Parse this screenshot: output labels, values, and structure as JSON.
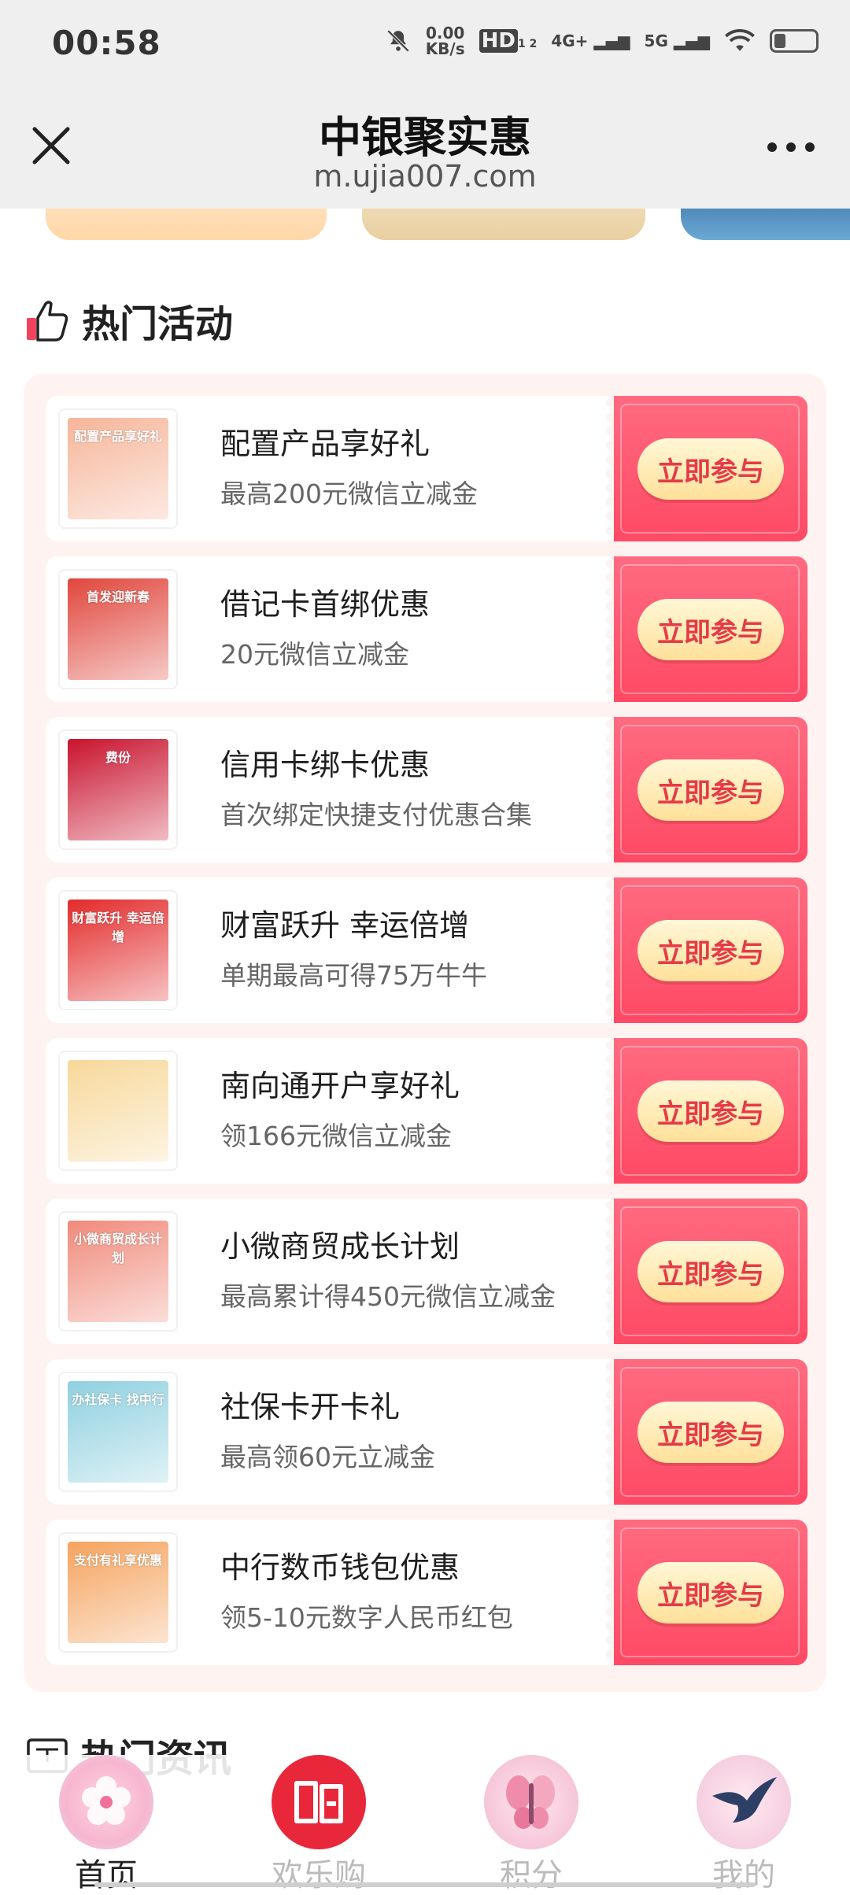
{
  "status_bar": {
    "time": "00:58",
    "net_speed_value": "0.00",
    "net_speed_unit": "KB/s",
    "hd_label": "HD",
    "hd_sub": "1 2",
    "sig1_label": "4G+",
    "sig2_label": "5G",
    "icons": [
      "mute-bell-icon",
      "wifi-icon",
      "battery-icon"
    ]
  },
  "header": {
    "title": "中银聚实惠",
    "url": "m.ujia007.com"
  },
  "hot_activities": {
    "title": "热门活动",
    "icon": "thumbs-up-icon",
    "items": [
      {
        "title": "配置产品享好礼",
        "subtitle": "最高200元微信立减金",
        "button": "立即参与",
        "thumb_text": "配置产品享好礼",
        "thumb_color": "#f6b59a"
      },
      {
        "title": "借记卡首绑优惠",
        "subtitle": "20元微信立减金",
        "button": "立即参与",
        "thumb_text": "首发迎新春",
        "thumb_color": "#e0463c"
      },
      {
        "title": "信用卡绑卡优惠",
        "subtitle": "首次绑定快捷支付优惠合集",
        "button": "立即参与",
        "thumb_text": "费份",
        "thumb_color": "#c9132e"
      },
      {
        "title": "财富跃升 幸运倍增",
        "subtitle": "单期最高可得75万牛牛",
        "button": "立即参与",
        "thumb_text": "财富跃升 幸运倍增",
        "thumb_color": "#e32a2a"
      },
      {
        "title": "南向通开户享好礼",
        "subtitle": "领166元微信立减金",
        "button": "立即参与",
        "thumb_text": "",
        "thumb_color": "#f7d89a"
      },
      {
        "title": "小微商贸成长计划",
        "subtitle": "最高累计得450元微信立减金",
        "button": "立即参与",
        "thumb_text": "小微商贸成长计划",
        "thumb_color": "#f08a7a"
      },
      {
        "title": "社保卡开卡礼",
        "subtitle": "最高领60元立减金",
        "button": "立即参与",
        "thumb_text": "办社保卡 找中行",
        "thumb_color": "#8fd0e0"
      },
      {
        "title": "中行数币钱包优惠",
        "subtitle": "领5-10元数字人民币红包",
        "button": "立即参与",
        "thumb_text": "支付有礼享优惠",
        "thumb_color": "#f5a35e"
      }
    ]
  },
  "hot_news": {
    "title": "热门资讯",
    "icon": "newspaper-icon"
  },
  "bottom_nav": {
    "items": [
      {
        "label": "首页",
        "icon": "cherry-blossom-icon",
        "active": true
      },
      {
        "label": "欢乐购",
        "icon": "shopping-gou-icon",
        "active": false
      },
      {
        "label": "积分",
        "icon": "butterfly-icon",
        "active": false
      },
      {
        "label": "我的",
        "icon": "swallow-icon",
        "active": false
      }
    ]
  },
  "colors": {
    "accent_red": "#ff4965",
    "button_text": "#e63a48",
    "panel_bg": "#fff3f2"
  }
}
